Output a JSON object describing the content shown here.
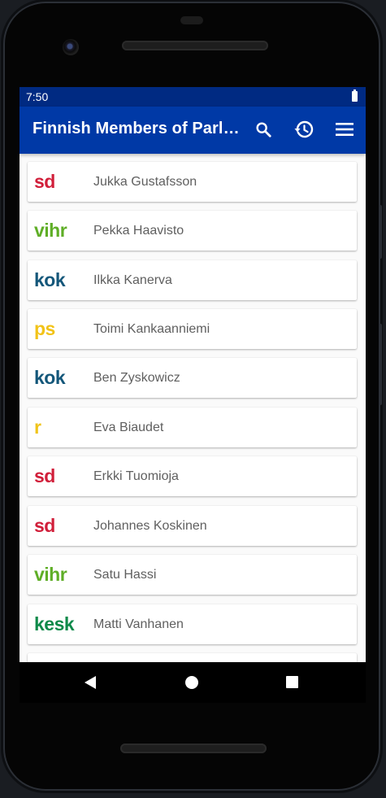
{
  "status_bar": {
    "time": "7:50"
  },
  "app_bar": {
    "title": "Finnish Members of Parliament",
    "actions": [
      "search-icon",
      "history-icon",
      "menu-icon"
    ]
  },
  "members": [
    {
      "party": "sd",
      "party_color": "#d11f3a",
      "name": "Jukka Gustafsson"
    },
    {
      "party": "vihr",
      "party_color": "#5fae27",
      "name": "Pekka Haavisto"
    },
    {
      "party": "kok",
      "party_color": "#14577a",
      "name": "Ilkka Kanerva"
    },
    {
      "party": "ps",
      "party_color": "#f2c318",
      "name": "Toimi Kankaanniemi"
    },
    {
      "party": "kok",
      "party_color": "#14577a",
      "name": "Ben Zyskowicz"
    },
    {
      "party": "r",
      "party_color": "#f0c419",
      "name": "Eva Biaudet"
    },
    {
      "party": "sd",
      "party_color": "#d11f3a",
      "name": "Erkki Tuomioja"
    },
    {
      "party": "sd",
      "party_color": "#d11f3a",
      "name": "Johannes Koskinen"
    },
    {
      "party": "vihr",
      "party_color": "#5fae27",
      "name": "Satu Hassi"
    },
    {
      "party": "kesk",
      "party_color": "#0f8a4a",
      "name": "Matti Vanhanen"
    }
  ],
  "nav_bar": {
    "buttons": [
      "back-icon",
      "home-icon",
      "recents-icon"
    ]
  },
  "colors": {
    "status_bar": "#002a82",
    "app_bar": "#0039a6",
    "background": "#fafafa"
  }
}
